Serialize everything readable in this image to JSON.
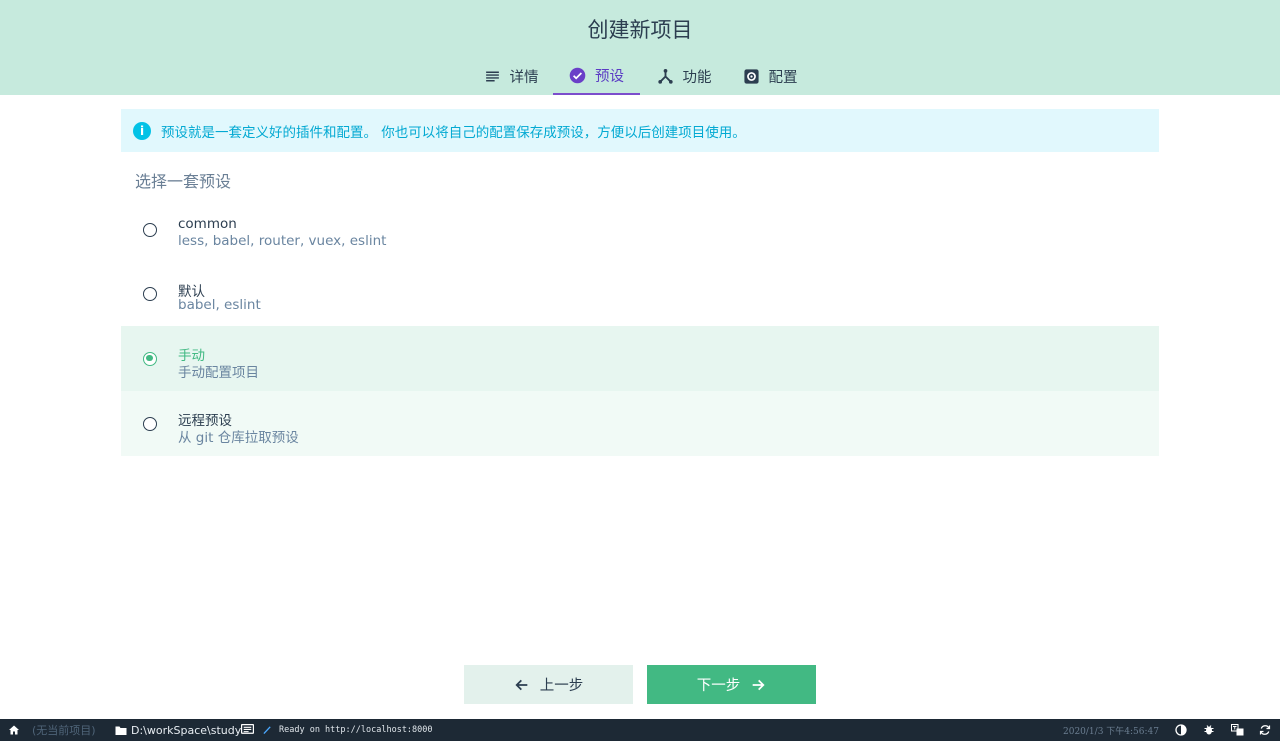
{
  "header": {
    "title": "创建新项目",
    "tabs": [
      {
        "label": "详情",
        "icon": "list-icon"
      },
      {
        "label": "预设",
        "icon": "check-circle-icon",
        "active": true
      },
      {
        "label": "功能",
        "icon": "fork-icon"
      },
      {
        "label": "配置",
        "icon": "settings-icon"
      }
    ]
  },
  "info": {
    "text": "预设就是一套定义好的插件和配置。 你也可以将自己的配置保存成预设，方便以后创建项目使用。"
  },
  "presets": {
    "title": "选择一套预设",
    "options": [
      {
        "name": "common",
        "description": "less, babel, router, vuex, eslint",
        "selected": false
      },
      {
        "name": "默认",
        "description": "babel, eslint",
        "selected": false
      },
      {
        "name": "手动",
        "description": "手动配置项目",
        "selected": true
      },
      {
        "name": "远程预设",
        "description": "从 git 仓库拉取预设",
        "selected": false
      }
    ]
  },
  "buttons": {
    "prev": "上一步",
    "next": "下一步"
  },
  "statusbar": {
    "project": "(无当前项目)",
    "path": "D:\\workSpace\\study",
    "log": "Ready on http://localhost:8000",
    "time": "2020/1/3 下午4:56:47"
  },
  "colors": {
    "header_bg": "#c6eadd",
    "accent_green": "#42b983",
    "accent_purple": "#5b3cc4",
    "info_bg": "#e1f8fd",
    "info_text": "#03a9d2",
    "statusbar_bg": "#1d2935"
  }
}
